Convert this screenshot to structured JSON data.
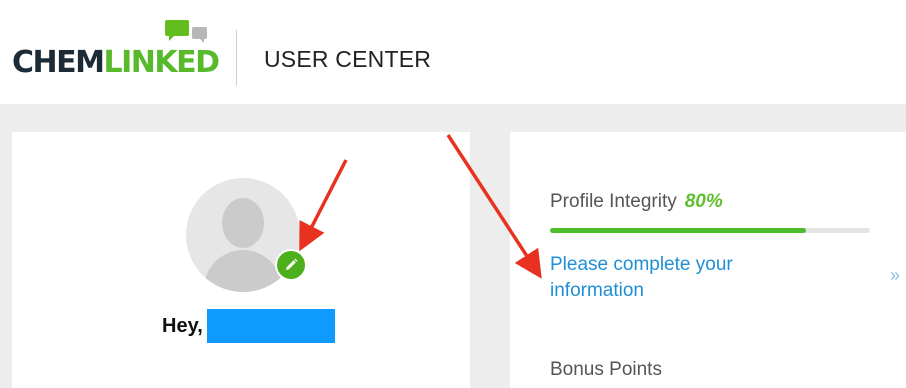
{
  "header": {
    "logo_text_dark": "CHEM",
    "logo_text_green": "LINKED",
    "title": "USER CENTER"
  },
  "profile_card": {
    "greeting": "Hey,",
    "avatar_icon": "user-silhouette-icon",
    "edit_icon": "pencil-icon",
    "name_redacted_color": "#0f9aff"
  },
  "stats_card": {
    "profile_integrity_label": "Profile Integrity",
    "profile_integrity_value": "80%",
    "profile_integrity_fraction": 0.8,
    "complete_link": "Please complete your information",
    "more_icon": "double-chevron-right-icon",
    "more_glyph": "»",
    "bonus_points_label": "Bonus Points"
  },
  "colors": {
    "brand_green": "#58b92a",
    "link_blue": "#1e8fd6",
    "annotation_red": "#e8321f"
  }
}
